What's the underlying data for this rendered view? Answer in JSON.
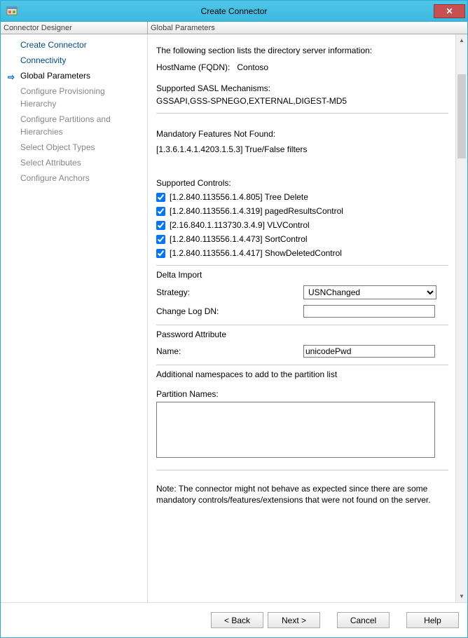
{
  "window": {
    "title": "Create Connector"
  },
  "columns": {
    "left": "Connector Designer",
    "right": "Global Parameters"
  },
  "nav": {
    "items": [
      {
        "label": "Create Connector",
        "sub": false,
        "current": false
      },
      {
        "label": "Connectivity",
        "sub": false,
        "current": false
      },
      {
        "label": "Global Parameters",
        "sub": false,
        "current": true
      },
      {
        "label": "Configure Provisioning Hierarchy",
        "sub": true,
        "current": false
      },
      {
        "label": "Configure Partitions and Hierarchies",
        "sub": true,
        "current": false
      },
      {
        "label": "Select Object Types",
        "sub": true,
        "current": false
      },
      {
        "label": "Select Attributes",
        "sub": true,
        "current": false
      },
      {
        "label": "Configure Anchors",
        "sub": true,
        "current": false
      }
    ]
  },
  "content": {
    "intro": "The following section lists the directory server information:",
    "host_label": "HostName (FQDN):",
    "host_value": "Contoso",
    "sasl_label": "Supported SASL Mechanisms:",
    "sasl_value": "GSSAPI,GSS-SPNEGO,EXTERNAL,DIGEST-MD5",
    "mandatory_label": "Mandatory Features Not Found:",
    "mandatory_value": "[1.3.6.1.4.1.4203.1.5.3] True/False filters",
    "controls_label": "Supported Controls:",
    "controls": [
      {
        "label": "[1.2.840.113556.1.4.805] Tree Delete",
        "checked": true
      },
      {
        "label": "[1.2.840.113556.1.4.319] pagedResultsControl",
        "checked": true
      },
      {
        "label": "[2.16.840.1.113730.3.4.9] VLVControl",
        "checked": true
      },
      {
        "label": "[1.2.840.113556.1.4.473] SortControl",
        "checked": true
      },
      {
        "label": "[1.2.840.113556.1.4.417] ShowDeletedControl",
        "checked": true
      }
    ],
    "delta_section": "Delta Import",
    "strategy_label": "Strategy:",
    "strategy_value": "USNChanged",
    "changelog_label": "Change Log DN:",
    "changelog_value": "",
    "pwd_section": "Password Attribute",
    "pwd_name_label": "Name:",
    "pwd_name_value": "unicodePwd",
    "namespaces_label": "Additional namespaces to add to the partition list",
    "partition_label": "Partition Names:",
    "partition_value": "",
    "note": "Note: The connector might not behave as expected since there are some mandatory controls/features/extensions that were not found on the server."
  },
  "footer": {
    "back": "<  Back",
    "next": "Next  >",
    "cancel": "Cancel",
    "help": "Help"
  }
}
